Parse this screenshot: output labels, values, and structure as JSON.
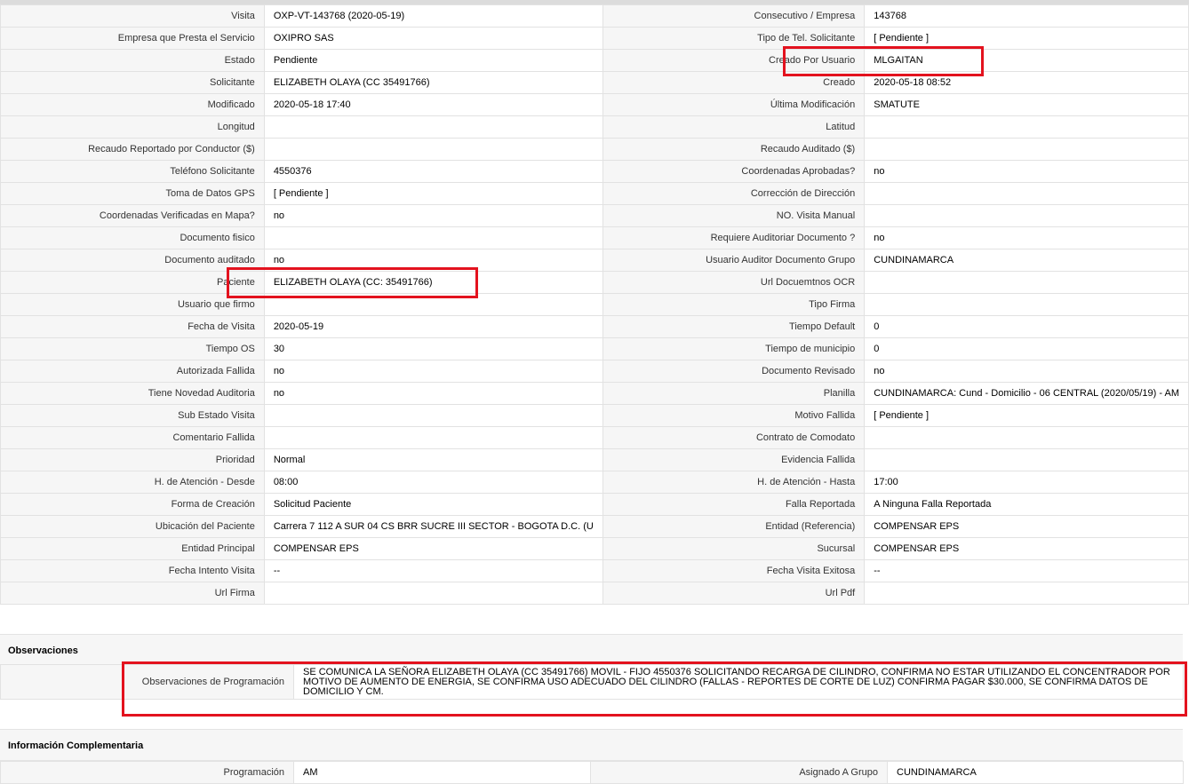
{
  "rows": [
    {
      "l1": "Visita",
      "v1": "OXP-VT-143768 (2020-05-19)",
      "l2": "Consecutivo / Empresa",
      "v2": "143768"
    },
    {
      "l1": "Empresa que Presta el Servicio",
      "v1": "OXIPRO SAS",
      "l2": "Tipo de Tel. Solicitante",
      "v2": "[ Pendiente ]"
    },
    {
      "l1": "Estado",
      "v1": "Pendiente",
      "l2": "Creado Por Usuario",
      "v2": "MLGAITAN"
    },
    {
      "l1": "Solicitante",
      "v1": "ELIZABETH OLAYA (CC 35491766)",
      "l2": "Creado",
      "v2": "2020-05-18 08:52"
    },
    {
      "l1": "Modificado",
      "v1": "2020-05-18 17:40",
      "l2": "Última Modificación",
      "v2": " SMATUTE"
    },
    {
      "l1": "Longitud",
      "v1": "",
      "l2": "Latitud",
      "v2": ""
    },
    {
      "l1": "Recaudo Reportado por Conductor ($)",
      "v1": "",
      "l2": "Recaudo Auditado ($)",
      "v2": ""
    },
    {
      "l1": "Teléfono Solicitante",
      "v1": "4550376",
      "l2": "Coordenadas Aprobadas?",
      "v2": " no"
    },
    {
      "l1": "Toma de Datos GPS",
      "v1": "[ Pendiente ]",
      "l2": "Corrección de Dirección",
      "v2": ""
    },
    {
      "l1": "Coordenadas Verificadas en Mapa?",
      "v1": " no",
      "l2": "NO. Visita Manual",
      "v2": ""
    },
    {
      "l1": "Documento fisico",
      "v1": "",
      "l2": "Requiere Auditoriar Documento ?",
      "v2": " no"
    },
    {
      "l1": "Documento auditado",
      "v1": " no",
      "l2": "Usuario Auditor Documento Grupo",
      "v2": "CUNDINAMARCA"
    },
    {
      "l1": "Paciente",
      "v1": "ELIZABETH OLAYA (CC: 35491766)",
      "l2": "Url Docuemtnos OCR",
      "v2": ""
    },
    {
      "l1": "Usuario que firmo",
      "v1": "",
      "l2": "Tipo Firma",
      "v2": ""
    },
    {
      "l1": "Fecha de Visita",
      "v1": " 2020-05-19",
      "l2": "Tiempo Default",
      "v2": "0"
    },
    {
      "l1": "Tiempo OS",
      "v1": "30",
      "l2": "Tiempo de municipio",
      "v2": "0"
    },
    {
      "l1": "Autorizada Fallida",
      "v1": " no",
      "l2": "Documento Revisado",
      "v2": " no"
    },
    {
      "l1": "Tiene Novedad Auditoria",
      "v1": " no",
      "l2": "Planilla",
      "v2": "CUNDINAMARCA: Cund - Domicilio - 06 CENTRAL (2020/05/19) - AM"
    },
    {
      "l1": "Sub Estado Visita",
      "v1": "",
      "l2": "Motivo Fallida",
      "v2": "[ Pendiente ]"
    },
    {
      "l1": "Comentario Fallida",
      "v1": "",
      "l2": "Contrato de Comodato",
      "v2": ""
    },
    {
      "l1": "Prioridad",
      "v1": "Normal",
      "l2": "Evidencia Fallida",
      "v2": ""
    },
    {
      "l1": "H. de Atención - Desde",
      "v1": "08:00",
      "l2": "H. de Atención - Hasta",
      "v2": "17:00"
    },
    {
      "l1": "Forma de Creación",
      "v1": "Solicitud Paciente",
      "l2": "Falla Reportada",
      "v2": "A Ninguna Falla Reportada"
    },
    {
      "l1": "Ubicación del Paciente",
      "v1": "Carrera 7 112 A SUR 04 CS BRR SUCRE III SECTOR - BOGOTA D.C. (U",
      "l2": "Entidad (Referencia)",
      "v2": "COMPENSAR EPS"
    },
    {
      "l1": "Entidad Principal",
      "v1": "COMPENSAR EPS",
      "l2": "Sucursal",
      "v2": "COMPENSAR EPS"
    },
    {
      "l1": "Fecha Intento Visita",
      "v1": " --",
      "l2": "Fecha Visita Exitosa",
      "v2": " --"
    },
    {
      "l1": "Url Firma",
      "v1": "",
      "l2": "Url Pdf",
      "v2": ""
    }
  ],
  "observaciones": {
    "title": "Observaciones",
    "label": "Observaciones de Programación",
    "text": "  SE COMUNICA LA SEÑORA ELIZABETH OLAYA (CC 35491766) MOVIL - FIJO 4550376 SOLICITANDO RECARGA DE CILINDRO, CONFIRMA NO ESTAR UTILIZANDO EL CONCENTRADOR POR MOTIVO DE AUMENTO DE ENERGIA, SE CONFIRMA USO ADECUADO DEL CILINDRO (FALLAS - REPORTES DE CORTE DE LUZ) CONFIRMA PAGAR $30.000, SE CONFIRMA DATOS DE DOMICILIO Y CM."
  },
  "complementaria": {
    "title": "Información Complementaria",
    "row": {
      "l1": "Programación",
      "v1": "AM",
      "l2": "Asignado A Grupo",
      "v2": "CUNDINAMARCA"
    }
  },
  "highlight_color": "#e3121e"
}
